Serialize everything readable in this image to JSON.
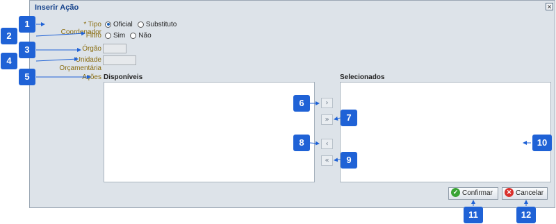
{
  "dialog": {
    "title": "Inserir Ação"
  },
  "icons": {
    "close": "close-icon",
    "confirm": "check-icon",
    "cancel": "cancel-x-icon"
  },
  "form": {
    "tipo_coordenador": {
      "label": "* Tipo Coordenador",
      "options": [
        "Oficial",
        "Substituto"
      ],
      "selected": "Oficial"
    },
    "filtro": {
      "label": "Filtro",
      "options": [
        "Sim",
        "Não"
      ],
      "selected": ""
    },
    "orgao": {
      "label": "Órgão",
      "value": ""
    },
    "unidade": {
      "label_line1": "Unidade",
      "label_line2": "Orçamentária",
      "value": ""
    },
    "acoes": {
      "label": "Ações"
    }
  },
  "lists": {
    "available_title": "Disponíveis",
    "selected_title": "Selecionados"
  },
  "transfer_buttons": {
    "move_right": "›",
    "move_all_right": "»",
    "move_left": "‹",
    "move_all_left": "«"
  },
  "footer": {
    "confirm_label": "Confirmar",
    "cancel_label": "Cancelar"
  },
  "callouts": [
    "1",
    "2",
    "3",
    "4",
    "5",
    "6",
    "7",
    "8",
    "9",
    "10",
    "11",
    "12"
  ],
  "colors": {
    "callout_bg": "#1f62d6",
    "label_text": "#8a6d10",
    "title_text": "#15428b",
    "confirm_icon": "#3aa435",
    "cancel_icon": "#d9302c"
  }
}
